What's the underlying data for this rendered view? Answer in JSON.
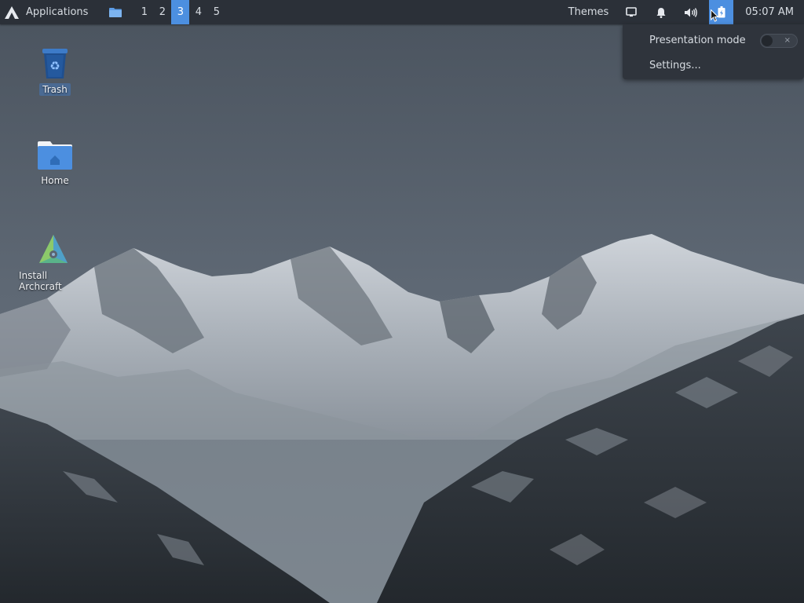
{
  "panel": {
    "applications_label": "Applications",
    "workspaces": [
      "1",
      "2",
      "3",
      "4",
      "5"
    ],
    "active_workspace": 2,
    "themes_label": "Themes",
    "clock": "05:07 AM",
    "accent_color": "#4c8fe0",
    "icons": [
      "archcraft-logo-icon",
      "file-manager-icon",
      "display-icon",
      "bell-icon",
      "volume-icon",
      "power-manager-icon"
    ]
  },
  "power_popup": {
    "presentation_mode_label": "Presentation mode",
    "presentation_mode_on": false,
    "toggle_off_glyph": "×",
    "settings_label": "Settings..."
  },
  "desktop": {
    "icons": [
      {
        "label": "Trash",
        "icon": "trash-icon",
        "selected": true
      },
      {
        "label": "Home",
        "icon": "home-folder-icon",
        "selected": false
      },
      {
        "label": "Install Archcraft",
        "icon": "install-archcraft-icon",
        "selected": false
      }
    ]
  }
}
